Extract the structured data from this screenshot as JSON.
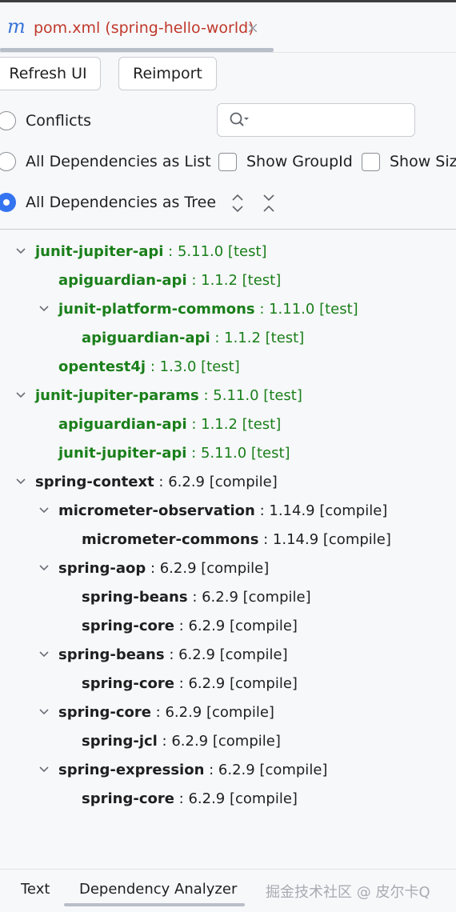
{
  "tab": {
    "icon": "maven-m-icon",
    "title": "pom.xml (spring-hello-world)",
    "close": "×"
  },
  "toolbar": {
    "refresh_label": "Refresh UI",
    "reimport_label": "Reimport"
  },
  "options": {
    "conflicts": "Conflicts",
    "list": "All Dependencies as List",
    "tree": "All Dependencies as Tree",
    "selected": "tree",
    "show_groupid": "Show GroupId",
    "show_size": "Show Size"
  },
  "search": {
    "value": "",
    "placeholder": ""
  },
  "tree": [
    {
      "name": "junit-jupiter-api",
      "detail": " : 5.11.0 [test]",
      "scope": "test",
      "level": 0,
      "expanded": true
    },
    {
      "name": "apiguardian-api",
      "detail": " : 1.1.2 [test]",
      "scope": "test",
      "level": 1,
      "expanded": null
    },
    {
      "name": "junit-platform-commons",
      "detail": " : 1.11.0 [test]",
      "scope": "test",
      "level": 1,
      "expanded": true
    },
    {
      "name": "apiguardian-api",
      "detail": " : 1.1.2 [test]",
      "scope": "test",
      "level": 2,
      "expanded": null
    },
    {
      "name": "opentest4j",
      "detail": " : 1.3.0 [test]",
      "scope": "test",
      "level": 1,
      "expanded": null
    },
    {
      "name": "junit-jupiter-params",
      "detail": " : 5.11.0 [test]",
      "scope": "test",
      "level": 0,
      "expanded": true
    },
    {
      "name": "apiguardian-api",
      "detail": " : 1.1.2 [test]",
      "scope": "test",
      "level": 1,
      "expanded": null
    },
    {
      "name": "junit-jupiter-api",
      "detail": " : 5.11.0 [test]",
      "scope": "test",
      "level": 1,
      "expanded": null
    },
    {
      "name": "spring-context",
      "detail": " : 6.2.9 [compile]",
      "scope": "compile",
      "level": 0,
      "expanded": true
    },
    {
      "name": "micrometer-observation",
      "detail": " : 1.14.9 [compile]",
      "scope": "compile",
      "level": 1,
      "expanded": true
    },
    {
      "name": "micrometer-commons",
      "detail": " : 1.14.9 [compile]",
      "scope": "compile",
      "level": 2,
      "expanded": null
    },
    {
      "name": "spring-aop",
      "detail": " : 6.2.9 [compile]",
      "scope": "compile",
      "level": 1,
      "expanded": true
    },
    {
      "name": "spring-beans",
      "detail": " : 6.2.9 [compile]",
      "scope": "compile",
      "level": 2,
      "expanded": null
    },
    {
      "name": "spring-core",
      "detail": " : 6.2.9 [compile]",
      "scope": "compile",
      "level": 2,
      "expanded": null
    },
    {
      "name": "spring-beans",
      "detail": " : 6.2.9 [compile]",
      "scope": "compile",
      "level": 1,
      "expanded": true
    },
    {
      "name": "spring-core",
      "detail": " : 6.2.9 [compile]",
      "scope": "compile",
      "level": 2,
      "expanded": null
    },
    {
      "name": "spring-core",
      "detail": " : 6.2.9 [compile]",
      "scope": "compile",
      "level": 1,
      "expanded": true
    },
    {
      "name": "spring-jcl",
      "detail": " : 6.2.9 [compile]",
      "scope": "compile",
      "level": 2,
      "expanded": null
    },
    {
      "name": "spring-expression",
      "detail": " : 6.2.9 [compile]",
      "scope": "compile",
      "level": 1,
      "expanded": true
    },
    {
      "name": "spring-core",
      "detail": " : 6.2.9 [compile]",
      "scope": "compile",
      "level": 2,
      "expanded": null
    }
  ],
  "bottom": {
    "text_tab": "Text",
    "analyzer_tab": "Dependency Analyzer",
    "watermark": "掘金技术社区 @ 皮尔卡Q"
  },
  "colors": {
    "test": "#1a7f1a",
    "compile": "#1f1f1f",
    "accent": "#3574f0",
    "tab_title": "#c0392b"
  }
}
